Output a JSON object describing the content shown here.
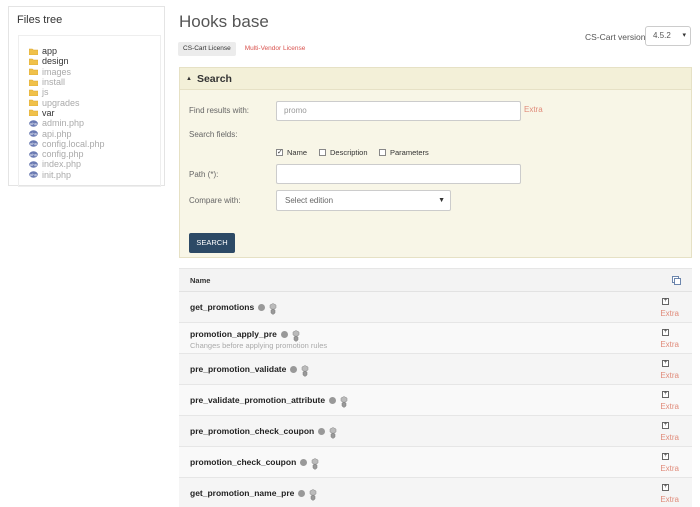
{
  "sidebar": {
    "title": "Files tree",
    "items": [
      {
        "label": "app",
        "icon": "folder-icon",
        "muted": false
      },
      {
        "label": "design",
        "icon": "folder-icon",
        "muted": false
      },
      {
        "label": "images",
        "icon": "folder-icon",
        "muted": true
      },
      {
        "label": "install",
        "icon": "folder-icon",
        "muted": true
      },
      {
        "label": "js",
        "icon": "folder-icon",
        "muted": true
      },
      {
        "label": "upgrades",
        "icon": "folder-icon",
        "muted": true
      },
      {
        "label": "var",
        "icon": "folder-icon",
        "muted": false
      },
      {
        "label": "admin.php",
        "icon": "php-file-icon",
        "muted": true
      },
      {
        "label": "api.php",
        "icon": "php-file-icon",
        "muted": true
      },
      {
        "label": "config.local.php",
        "icon": "php-file-icon",
        "muted": true
      },
      {
        "label": "config.php",
        "icon": "php-file-icon",
        "muted": true
      },
      {
        "label": "index.php",
        "icon": "php-file-icon",
        "muted": true
      },
      {
        "label": "init.php",
        "icon": "php-file-icon",
        "muted": true
      }
    ]
  },
  "header": {
    "title": "Hooks base",
    "license_tabs": [
      "CS-Cart License",
      "Multi-Vendor License"
    ],
    "version_label": "CS-Cart version:",
    "version_value": "4.5.2"
  },
  "search": {
    "title": "Search",
    "find_label": "Find results with:",
    "find_value": "promo",
    "extra_label": "Extra",
    "fields_label": "Search fields:",
    "fields": [
      {
        "label": "Name",
        "checked": true
      },
      {
        "label": "Description",
        "checked": false
      },
      {
        "label": "Parameters",
        "checked": false
      }
    ],
    "path_label": "Path (*):",
    "path_value": "",
    "compare_label": "Compare with:",
    "compare_value": "Select edition",
    "button_label": "SEARCH"
  },
  "results": {
    "column_name": "Name",
    "extra_label": "Extra",
    "rows": [
      {
        "name": "get_promotions",
        "desc": ""
      },
      {
        "name": "promotion_apply_pre",
        "desc": "Changes before applying promotion rules"
      },
      {
        "name": "pre_promotion_validate",
        "desc": ""
      },
      {
        "name": "pre_validate_promotion_attribute",
        "desc": ""
      },
      {
        "name": "pre_promotion_check_coupon",
        "desc": ""
      },
      {
        "name": "promotion_check_coupon",
        "desc": ""
      },
      {
        "name": "get_promotion_name_pre",
        "desc": ""
      }
    ]
  },
  "colors": {
    "accent_button": "#2d4a66",
    "extra_link": "#e08b7a",
    "search_panel_bg": "#f8f6e7",
    "folder": "#f0c14b",
    "php_icon": "#6b7bb3"
  }
}
